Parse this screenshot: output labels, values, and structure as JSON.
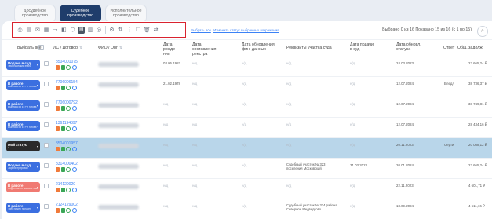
{
  "tabs": [
    {
      "label": "Досудебное производство",
      "active": false
    },
    {
      "label": "Судебное производство",
      "active": true
    },
    {
      "label": "Исполнительное производство",
      "active": false
    }
  ],
  "toolbar": {
    "icons": [
      "print-icon",
      "sms-icon",
      "envelope-icon",
      "calendar-icon",
      "card-icon",
      "money-icon",
      "certificate-icon",
      "document-icon",
      "download-icon",
      "layers-icon",
      "settings-icon",
      "sort-icon",
      "more-icon",
      "copy-icon",
      "delete-icon",
      "arrows-icon"
    ],
    "select_all_link": "Выбрать всё",
    "change_status_link": "Изменить статус выбранных возражения",
    "selection_status": "Выбрано 0 из 16    Показано 15 из 16 (с 1 по 15)"
  },
  "columns": {
    "select_all": "Выбрать все",
    "account": "ЛС / Договор",
    "fio": "ФИО / Орг",
    "birth": "Дата рожде ния",
    "registry_date": "Дата составления реестра",
    "update_date": "Дата обновления фин. данных",
    "court": "Реквизиты участка суда",
    "submit_date": "Дата подачи в суд",
    "status_update": "Дата обновл. статуса",
    "respondent": "Ответ",
    "debt": "Общ. задолж."
  },
  "na": "н/д",
  "rows": [
    {
      "status": "Подано в суд",
      "sub": "Тематический этапа",
      "color": "#3b6fe0",
      "account": "8504001075",
      "birth": "03.05.1982",
      "court": "",
      "submit": "",
      "status_date": "24.03.2023",
      "resp": "",
      "debt": "23 665,24 ₽",
      "hl": false
    },
    {
      "status": "В работе",
      "sub": "Выписка из ЕГРН готова",
      "color": "#3b6fe0",
      "account": "7706006154",
      "birth": "21.02.1978",
      "court": "",
      "submit": "",
      "status_date": "12.07.2024",
      "resp": "Вледл",
      "debt": "38 736,37 ₽",
      "hl": false
    },
    {
      "status": "В работе",
      "sub": "Выписка из ЕГРН готова",
      "color": "#3b6fe0",
      "account": "7706000792",
      "birth": "",
      "court": "",
      "submit": "",
      "status_date": "12.07.2024",
      "resp": "",
      "debt": "38 749,81 ₽",
      "hl": false
    },
    {
      "status": "В работе",
      "sub": "Выписка из ЕГРН готова",
      "color": "#3b6fe0",
      "account": "1361194897",
      "birth": "",
      "court": "",
      "submit": "",
      "status_date": "12.07.2024",
      "resp": "",
      "debt": "28 434,16 ₽",
      "hl": false
    },
    {
      "status": "Мой статус",
      "sub": "1",
      "color": "#2a2a2a",
      "account": "8504001957",
      "birth": "",
      "court": "",
      "submit": "",
      "status_date": "20.11.2023",
      "resp": "Серти",
      "debt": "20 088,12 ₽",
      "hl": true
    },
    {
      "status": "Подано в суд",
      "sub": "Зарегистрирован",
      "color": "#3b6fe0",
      "account": "8314000402",
      "birth": "",
      "court": "Судебный участок № 323 поселения Московский",
      "submit": "31.03.2023",
      "status_date": "20.01.2024",
      "resp": "",
      "debt": "23 665,24 ₽",
      "hl": false
    },
    {
      "status": "В работе",
      "sub": "Подготовлен исковое заявление",
      "color": "#f07a72",
      "account": "214120020",
      "birth": "",
      "court": "",
      "submit": "",
      "status_date": "22.11.2023",
      "resp": "",
      "debt": "4 601,71 ₽",
      "hl": false
    },
    {
      "status": "В работе",
      "sub": "Трек номер получен",
      "color": "#3b6fe0",
      "account": "2124129002",
      "birth": "",
      "court": "Судебный участок № 324 района Северное Медведково",
      "submit": "",
      "status_date": "18.09.2024",
      "resp": "",
      "debt": "4 611,16 ₽",
      "hl": false
    }
  ]
}
